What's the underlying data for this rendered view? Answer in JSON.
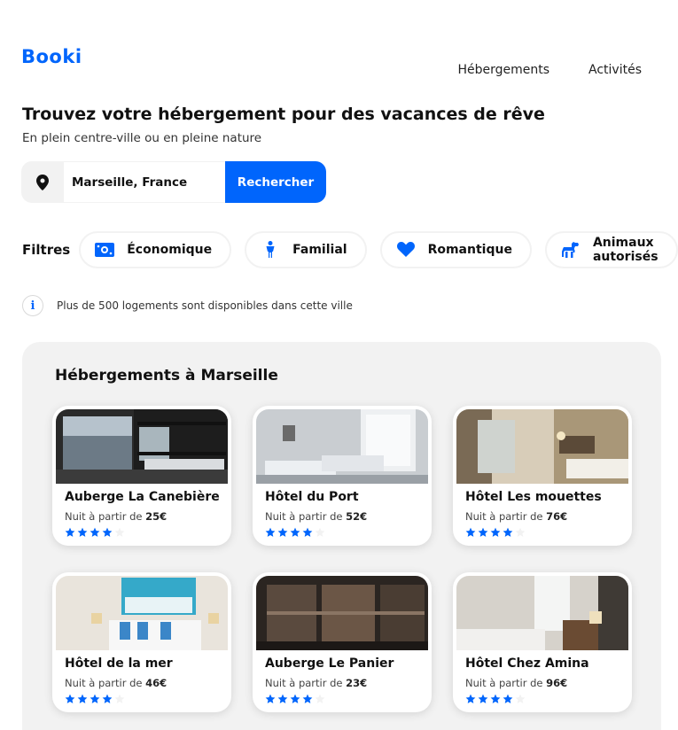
{
  "brand": {
    "logo": "Booki"
  },
  "nav": {
    "items": [
      "Hébergements",
      "Activités"
    ]
  },
  "hero": {
    "title": "Trouvez votre hébergement pour des vacances de rêve",
    "subtitle": "En plein centre-ville ou en pleine nature"
  },
  "search": {
    "value": "Marseille, France",
    "button_label": "Rechercher",
    "icon": "location-pin-icon"
  },
  "filters": {
    "label": "Filtres",
    "chips": [
      {
        "label": "Économique",
        "icon": "money-icon"
      },
      {
        "label": "Familial",
        "icon": "person-icon"
      },
      {
        "label": "Romantique",
        "icon": "heart-icon"
      },
      {
        "label": "Animaux autorisés",
        "icon": "dog-icon"
      }
    ]
  },
  "info": {
    "icon": "info-icon",
    "text": "Plus de 500 logements sont disponibles dans cette ville"
  },
  "listings": {
    "title": "Hébergements à Marseille",
    "price_prefix": "Nuit à partir de",
    "cards": [
      {
        "name": "Auberge La Canebière",
        "price": "25€",
        "rating": 4
      },
      {
        "name": "Hôtel du Port",
        "price": "52€",
        "rating": 4
      },
      {
        "name": "Hôtel Les mouettes",
        "price": "76€",
        "rating": 4
      },
      {
        "name": "Hôtel de la mer",
        "price": "46€",
        "rating": 4
      },
      {
        "name": "Auberge Le Panier",
        "price": "23€",
        "rating": 4
      },
      {
        "name": "Hôtel Chez Amina",
        "price": "96€",
        "rating": 4
      }
    ]
  },
  "colors": {
    "accent": "#0065FC",
    "panel_bg": "#F2F2F2",
    "star_empty": "#F2F2F2"
  }
}
